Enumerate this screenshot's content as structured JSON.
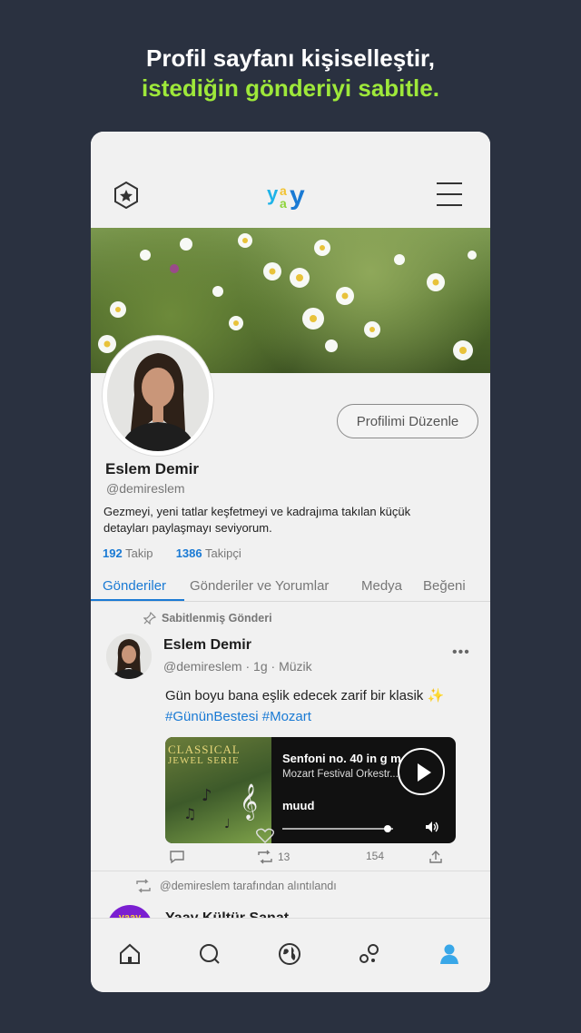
{
  "promo": {
    "line1": "Profil sayfanı kişiselleştir,",
    "line2": "istediğin gönderiyi sabitle."
  },
  "header": {
    "logo_text": "yaay",
    "icons": [
      "badge-star-icon",
      "yaay-logo",
      "hamburger-menu-icon"
    ]
  },
  "profile": {
    "edit_button": "Profilimi Düzenle",
    "name": "Eslem Demir",
    "handle": "@demireslem",
    "bio": "Gezmeyi, yeni tatlar keşfetmeyi ve kadrajıma takılan küçük detayları paylaşmayı seviyorum.",
    "following_count": "192",
    "following_label": "Takip",
    "followers_count": "1386",
    "followers_label": "Takipçi"
  },
  "tabs": [
    {
      "label": "Gönderiler",
      "active": true
    },
    {
      "label": "Gönderiler ve Yorumlar",
      "active": false
    },
    {
      "label": "Medya",
      "active": false
    },
    {
      "label": "Beğeni",
      "active": false
    }
  ],
  "pinned_post": {
    "pinned_label": "Sabitlenmiş Gönderi",
    "author_name": "Eslem Demir",
    "author_handle": "@demireslem",
    "separator": "·",
    "time": "1g",
    "category": "Müzik",
    "text": "Gün boyu bana eşlik edecek zarif bir klasik ✨",
    "hashtags": "#GününBestesi #Mozart",
    "player": {
      "album_text_1": "CLASSICAL",
      "album_text_2": "JEWEL SERIE",
      "track": "Senfoni no. 40 in g m...",
      "artist": "Mozart Festival Orkestr...",
      "service": "muud",
      "progress": 0.95
    },
    "actions": {
      "reposts": "13",
      "likes": "154"
    }
  },
  "quoted_post": {
    "label": "@demireslem tarafından alıntılandı",
    "avatar_text": "yaay",
    "author_name": "Yaay Kültür Sanat"
  },
  "bottom_nav": [
    "home-icon",
    "search-icon",
    "globe-icon",
    "bubbles-icon",
    "profile-icon"
  ],
  "colors": {
    "background": "#2a3140",
    "accent_green": "#9ee83a",
    "accent_blue": "#1a7ad4"
  }
}
